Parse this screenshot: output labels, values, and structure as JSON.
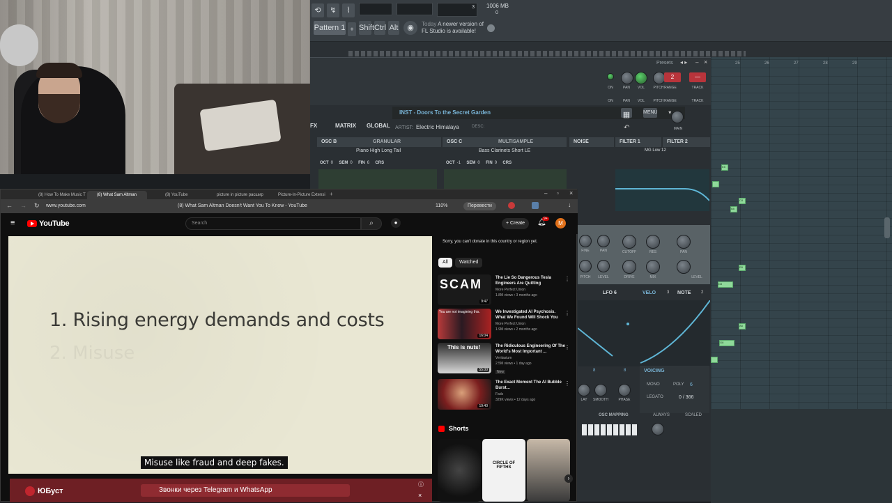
{
  "fl_studio": {
    "pattern_label": "Pattern 1",
    "modifier_keys": [
      "Shift",
      "Ctrl",
      "Alt"
    ],
    "news_time": "Today",
    "news_text_1": "A newer version of",
    "news_text_2": "FL Studio is available!",
    "mem_value": "1006 MB",
    "cpu_value": "3",
    "poly_value": "0",
    "presets_label": "Presets",
    "plugin_tabs": [
      "FX",
      "MATRIX",
      "GLOBAL"
    ],
    "preset_name": "INST - Doors To the Secret Garden",
    "artist_label": "ARTIST:",
    "artist_name": "Electric Himalaya",
    "desc_label": "DESC:",
    "menu_label": "MENU",
    "main_label": "MAIN",
    "top_knobs": [
      "ON",
      "PAN",
      "VOL",
      "PITCH",
      "TRACK"
    ],
    "top_num": "2",
    "range_label": "RANGE",
    "osc_headers": [
      {
        "name": "OSC B",
        "mode": "GRANULAR"
      },
      {
        "name": "OSC C",
        "mode": "MULTISAMPLE"
      },
      {
        "name": "NOISE",
        "mode": ""
      },
      {
        "name": "FILTER 1",
        "mode": ""
      },
      {
        "name": "FILTER 2",
        "mode": ""
      }
    ],
    "osc_b_sample": "Piano High Long Tail",
    "osc_c_sample": "Bass Clarinets Short LE",
    "filter_type": "MG Low 12",
    "osc_b_params": {
      "oct": "0",
      "sem": "0",
      "fin": "6",
      "crs": "CRS"
    },
    "osc_c_params": {
      "oct": "-1",
      "sem": "0",
      "fin": "0",
      "crs": "CRS"
    },
    "filter_knobs": [
      "CUTOFF",
      "RES",
      "PAN",
      "DRIVE",
      "MIX",
      "LEVEL"
    ],
    "osc_knobs": [
      "FINE",
      "PAN",
      "PITCH",
      "LEVEL"
    ],
    "mod_tabs": [
      "LFO 6",
      "VELO",
      "NOTE"
    ],
    "mod_nums": [
      "3",
      "2"
    ],
    "voicing_title": "VOICING",
    "mono_label": "MONO",
    "poly_label": "POLY",
    "poly_count": "6",
    "legato_label": "LEGATO",
    "legato_value": "0 / 366",
    "env_knobs": [
      "LAY",
      "SMOOTH",
      "PHASE"
    ],
    "env_nums": [
      "8",
      "8"
    ],
    "osc_mapping": "OSC MAPPING",
    "always_label": "ALWAYS",
    "scaled_label": "SCALED",
    "roll_numbers": [
      "25",
      "26",
      "27",
      "28",
      "29"
    ],
    "roll_notes": [
      "E8",
      "C8",
      "B8",
      "E8",
      "D8",
      "A8",
      "G8"
    ]
  },
  "browser": {
    "tabs": [
      "(8) How To Make Music T",
      "(8) What Sam Altman",
      "(8) YouTube",
      "picture in picture расшир",
      "Picture-In-Picture Extensi"
    ],
    "url": "www.youtube.com",
    "page_title": "(8) What Sam Altman Doesn't Want You To Know - YouTube",
    "zoom": "110%",
    "translate": "Перевести"
  },
  "youtube": {
    "logo": "YouTube",
    "search_placeholder": "Search",
    "create_label": "Create",
    "notif_count": "9+",
    "avatar_letter": "M",
    "slide_line1": "1. Rising energy demands and costs",
    "slide_line2": "2. Misuse",
    "subtitle": "Misuse like fraud and deep fakes.",
    "donate_notice": "Sorry, you can't donate in this country or region yet.",
    "chips": [
      "All",
      "Watched"
    ],
    "videos": [
      {
        "title": "The Lie So Dangerous Tesla Engineers Are Quitting",
        "channel": "More Perfect Union",
        "meta": "1.8M views • 3 months ago",
        "duration": "9:47",
        "thumb_text": "SCAM",
        "badge": ""
      },
      {
        "title": "We Investigated AI Psychosis. What We Found Will Shock You",
        "channel": "More Perfect Union",
        "meta": "1.9M views • 2 months ago",
        "duration": "16:04",
        "thumb_text": "You are not imagining this.",
        "badge": ""
      },
      {
        "title": "The Ridiculous Engineering Of The World's Most Important ...",
        "channel": "Veritasium",
        "meta": "2.5M views • 1 day ago",
        "duration": "55:00",
        "thumb_text": "This is nuts!",
        "badge": "New"
      },
      {
        "title": "The Exact Moment The AI Bubble Burst...",
        "channel": "Fads",
        "meta": "329K views • 12 days ago",
        "duration": "19:40",
        "thumb_text": "",
        "badge": ""
      }
    ],
    "shorts_label": "Shorts",
    "short_texts": [
      "",
      "CIRCLE OF FIFTHS",
      ""
    ]
  },
  "ad": {
    "brand": "ЮБуст",
    "message": "Звонки через Telegram и WhatsApp"
  },
  "colors": {
    "yt_red": "#ff0000",
    "fl_green": "#8fd99a",
    "fl_blue": "#7ab6d8",
    "ad_red": "#6e1f24"
  }
}
